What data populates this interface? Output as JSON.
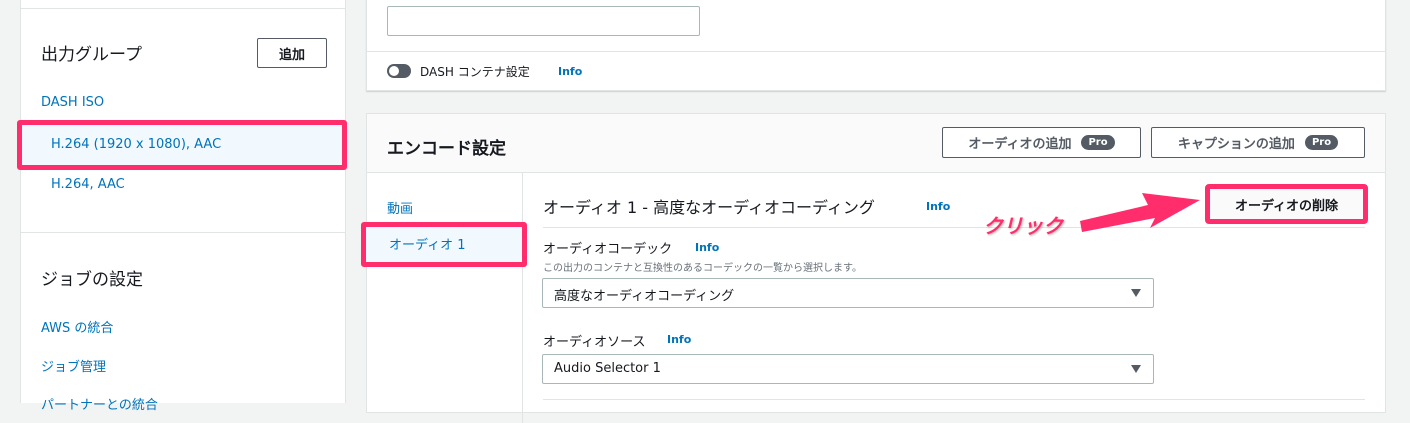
{
  "sidebar": {
    "output_groups_title": "出力グループ",
    "add_label": "追加",
    "group_name": "DASH ISO",
    "outputs": [
      "H.264 (1920 x 1080), AAC",
      "H.264, AAC"
    ],
    "job_settings_title": "ジョブの設定",
    "job_items": [
      "AWS の統合",
      "ジョブ管理",
      "パートナーとの統合"
    ]
  },
  "top_card": {
    "input_value": "",
    "toggle_label": "DASH コンテナ設定",
    "info": "Info",
    "toggle_on": false
  },
  "encode": {
    "title": "エンコード設定",
    "add_audio": "オーディオの追加",
    "add_caption": "キャプションの追加",
    "pro": "Pro",
    "tabs": [
      "動画",
      "オーディオ 1"
    ],
    "section_title": "オーディオ 1 - 高度なオーディオコーディング",
    "info": "Info",
    "remove_audio": "オーディオの削除",
    "codec_label": "オーディオコーデック",
    "codec_desc": "この出力のコンテナと互換性のあるコーデックの一覧から選択します。",
    "codec_value": "高度なオーディオコーディング",
    "source_label": "オーディオソース",
    "source_value": "Audio Selector 1"
  },
  "annotation": {
    "click_label": "クリック",
    "color": "#ff2d6b"
  }
}
